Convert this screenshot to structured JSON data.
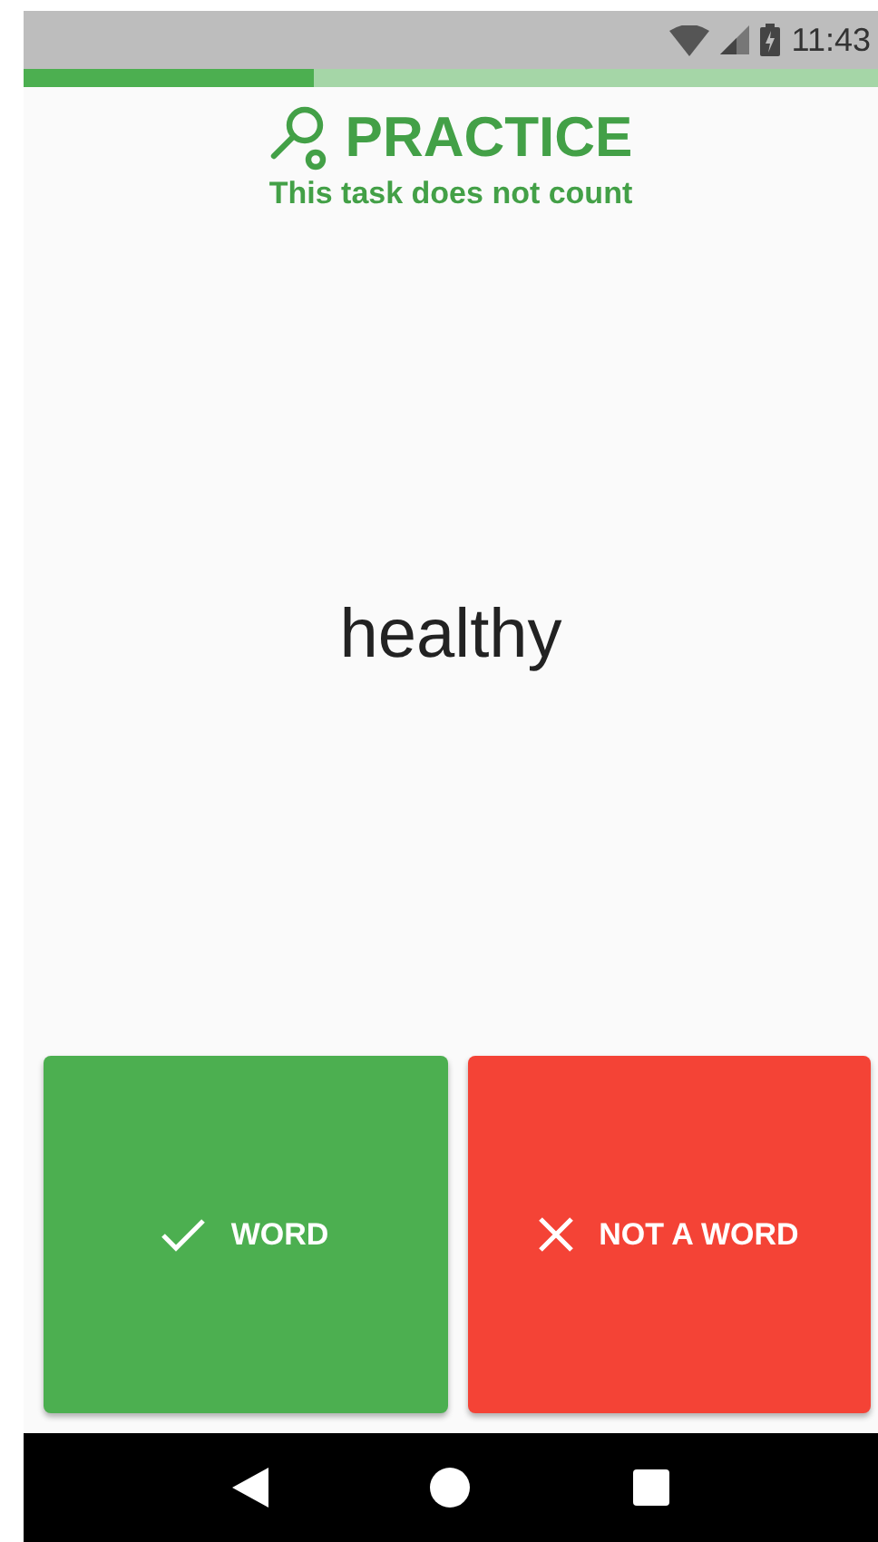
{
  "status_bar": {
    "time": "11:43"
  },
  "progress": {
    "level": 0.34
  },
  "header": {
    "title": "PRACTICE",
    "subtitle": "This task does not count"
  },
  "stimulus": "healthy",
  "buttons": [
    {
      "kind": "yes",
      "label": "WORD"
    },
    {
      "kind": "no",
      "label": "NOT A WORD"
    }
  ]
}
